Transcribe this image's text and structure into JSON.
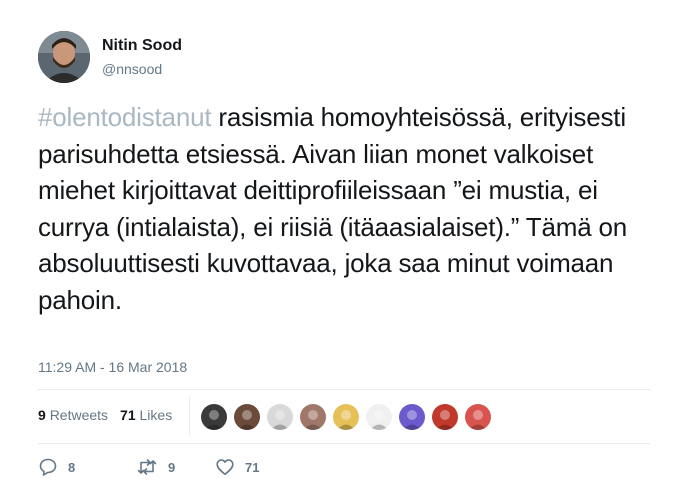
{
  "author": {
    "name": "Nitin Sood",
    "handle": "@nnsood"
  },
  "tweet": {
    "hashtag": "#olentodistanut",
    "body": " rasismia homoyhteisössä, erityisesti parisuhdetta etsiessä. Aivan liian monet valkoiset miehet kirjoittavat deittiprofiileissaan ”ei mustia, ei currya (intialaista), ei riisiä (itäaasialaiset).” Tämä on absoluuttisesti kuvottavaa, joka saa minut voimaan pahoin.",
    "timestamp": "11:29 AM - 16 Mar 2018"
  },
  "stats": {
    "retweets_count": "9",
    "retweets_label": "Retweets",
    "likes_count": "71",
    "likes_label": "Likes"
  },
  "likers": [
    {
      "name": "liker-avatar-1",
      "color": "#3a3a3a"
    },
    {
      "name": "liker-avatar-2",
      "color": "#6b4a3a"
    },
    {
      "name": "liker-avatar-3",
      "color": "#d8d8d8"
    },
    {
      "name": "liker-avatar-4",
      "color": "#a0786a"
    },
    {
      "name": "liker-avatar-5",
      "color": "#e6c15a"
    },
    {
      "name": "liker-avatar-6",
      "color": "#f0f0f0"
    },
    {
      "name": "liker-avatar-7",
      "color": "#6a5acd"
    },
    {
      "name": "liker-avatar-8",
      "color": "#c0392b"
    },
    {
      "name": "liker-avatar-9",
      "color": "#d9534f"
    }
  ],
  "actions": {
    "reply_count": "8",
    "retweet_count": "9",
    "like_count": "71"
  },
  "colors": {
    "hashtag": "#aab8c2",
    "secondary_text": "#657786",
    "divider": "#e6ecf0"
  }
}
